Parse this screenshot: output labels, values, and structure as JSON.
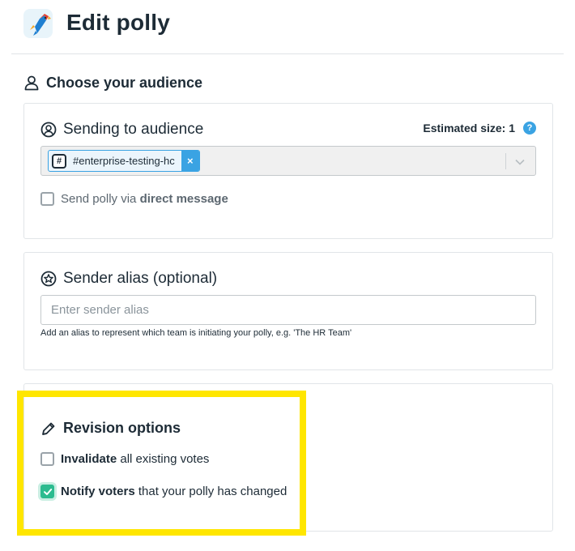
{
  "header": {
    "title": "Edit polly",
    "logo_icon": "polly-parrot-logo"
  },
  "section": {
    "heading": "Choose your audience",
    "icon": "user-icon"
  },
  "audience_card": {
    "title": "Sending to audience",
    "estimated_size_label": "Estimated size: 1",
    "help_glyph": "?",
    "selected_tags": [
      {
        "label": "#enterprise-testing-hc",
        "icon": "slack-channel-hash-icon",
        "remove_glyph": "×"
      }
    ],
    "direct_message": {
      "checked": false,
      "label_prefix": "Send polly via ",
      "label_bold": "direct message"
    }
  },
  "alias_card": {
    "title": "Sender alias (optional)",
    "input_value": "",
    "input_placeholder": "Enter sender alias",
    "hint": "Add an alias to represent which team is initiating your polly, e.g. 'The HR Team'"
  },
  "revision_card": {
    "title": "Revision options",
    "options": [
      {
        "bold": "Invalidate",
        "rest": " all existing votes",
        "checked": false
      },
      {
        "bold": "Notify voters",
        "rest": " that your polly has changed",
        "checked": true
      }
    ]
  },
  "colors": {
    "accent_blue": "#3aa3e3",
    "check_green": "#2cbb8f",
    "highlight_yellow": "#ffe600",
    "text_dark": "#1d2b36"
  }
}
